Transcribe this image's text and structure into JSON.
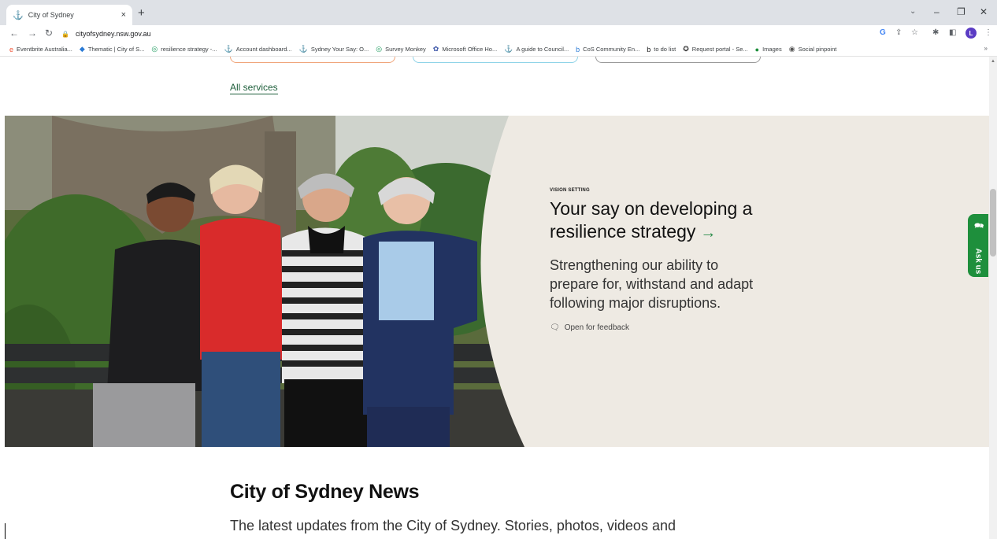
{
  "browser": {
    "tab_title": "City of Sydney",
    "tab_close": "×",
    "new_tab": "+",
    "url": "cityofsydney.nsw.gov.au",
    "profile_initial": "L",
    "bookmarks": [
      {
        "label": "Eventbrite Australia...",
        "icon": "eventbrite-icon",
        "color": "#f05537"
      },
      {
        "label": "Thematic | City of S...",
        "icon": "thematic-icon",
        "color": "#2a7ad5"
      },
      {
        "label": "resilience strategy -...",
        "icon": "survey-icon",
        "color": "#1a9a5c"
      },
      {
        "label": "Account dashboard...",
        "icon": "anchor-icon",
        "color": "#222"
      },
      {
        "label": "Sydney Your Say: O...",
        "icon": "anchor-icon",
        "color": "#222"
      },
      {
        "label": "Survey Monkey",
        "icon": "survey-icon",
        "color": "#1a9a5c"
      },
      {
        "label": "Microsoft Office Ho...",
        "icon": "office-icon",
        "color": "#3d57a8"
      },
      {
        "label": "A guide to Council...",
        "icon": "anchor-icon",
        "color": "#222"
      },
      {
        "label": "CoS Community En...",
        "icon": "b-icon",
        "color": "#2a7ad5"
      },
      {
        "label": "to do list",
        "icon": "b-icon",
        "color": "#111"
      },
      {
        "label": "Request portal - Se...",
        "icon": "award-icon",
        "color": "#333"
      },
      {
        "label": "Images",
        "icon": "images-icon",
        "color": "#1e8f3c"
      },
      {
        "label": "Social pinpoint",
        "icon": "pin-icon",
        "color": "#555"
      }
    ],
    "bookmarks_more": "»"
  },
  "page": {
    "all_services": "All services",
    "hero": {
      "eyebrow": "VISION SETTING",
      "title": "Your say on developing a resilience strategy",
      "arrow": "→",
      "description": "Strengthening our ability to prepare for, withstand and adapt following major disruptions.",
      "status": "Open for feedback"
    },
    "ask_us": "Ask us",
    "news": {
      "title": "City of Sydney News",
      "description": "The latest updates from the City of Sydney. Stories, photos, videos and"
    }
  },
  "colors": {
    "accent_green": "#1e8f3c",
    "hero_bg": "#eeeae3"
  }
}
